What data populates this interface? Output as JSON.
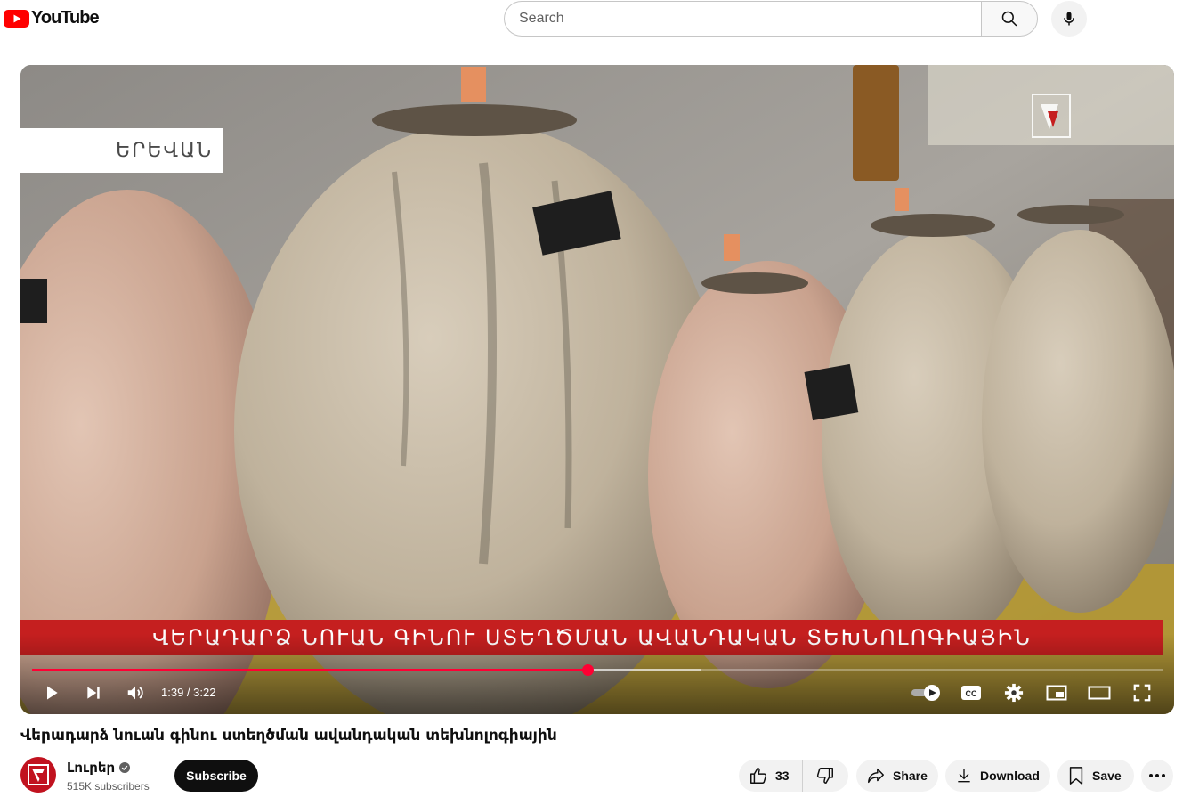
{
  "header": {
    "logo_text": "YouTube",
    "search_placeholder": "Search"
  },
  "video": {
    "location_label": "ԵՐԵՎԱՆ",
    "lower_third": "ՎԵՐԱԴԱՐՁ ՆՈՒԱՆ ԳԻՆՈՒ ՍՏԵՂԾՄԱՆ ԱՎԱՆԴԱԿԱՆ ՏԵԽՆՈԼՈԳԻԱՅԻՆ",
    "time_display": "1:39 / 3:22",
    "progress_played_percent": 49.1,
    "progress_loaded_percent": 59.1
  },
  "info": {
    "title": "Վերադարձ նուան գինու ստեղծման ավանդական տեխնոլոգիային",
    "channel_name": "Լուրեր",
    "subscriber_count": "515K subscribers",
    "subscribe_label": "Subscribe",
    "like_count": "33",
    "share_label": "Share",
    "download_label": "Download",
    "save_label": "Save"
  },
  "colors": {
    "brand_red": "#ff0000",
    "progress_red": "#ff0033",
    "lower_third_red": "#c51f1f"
  }
}
